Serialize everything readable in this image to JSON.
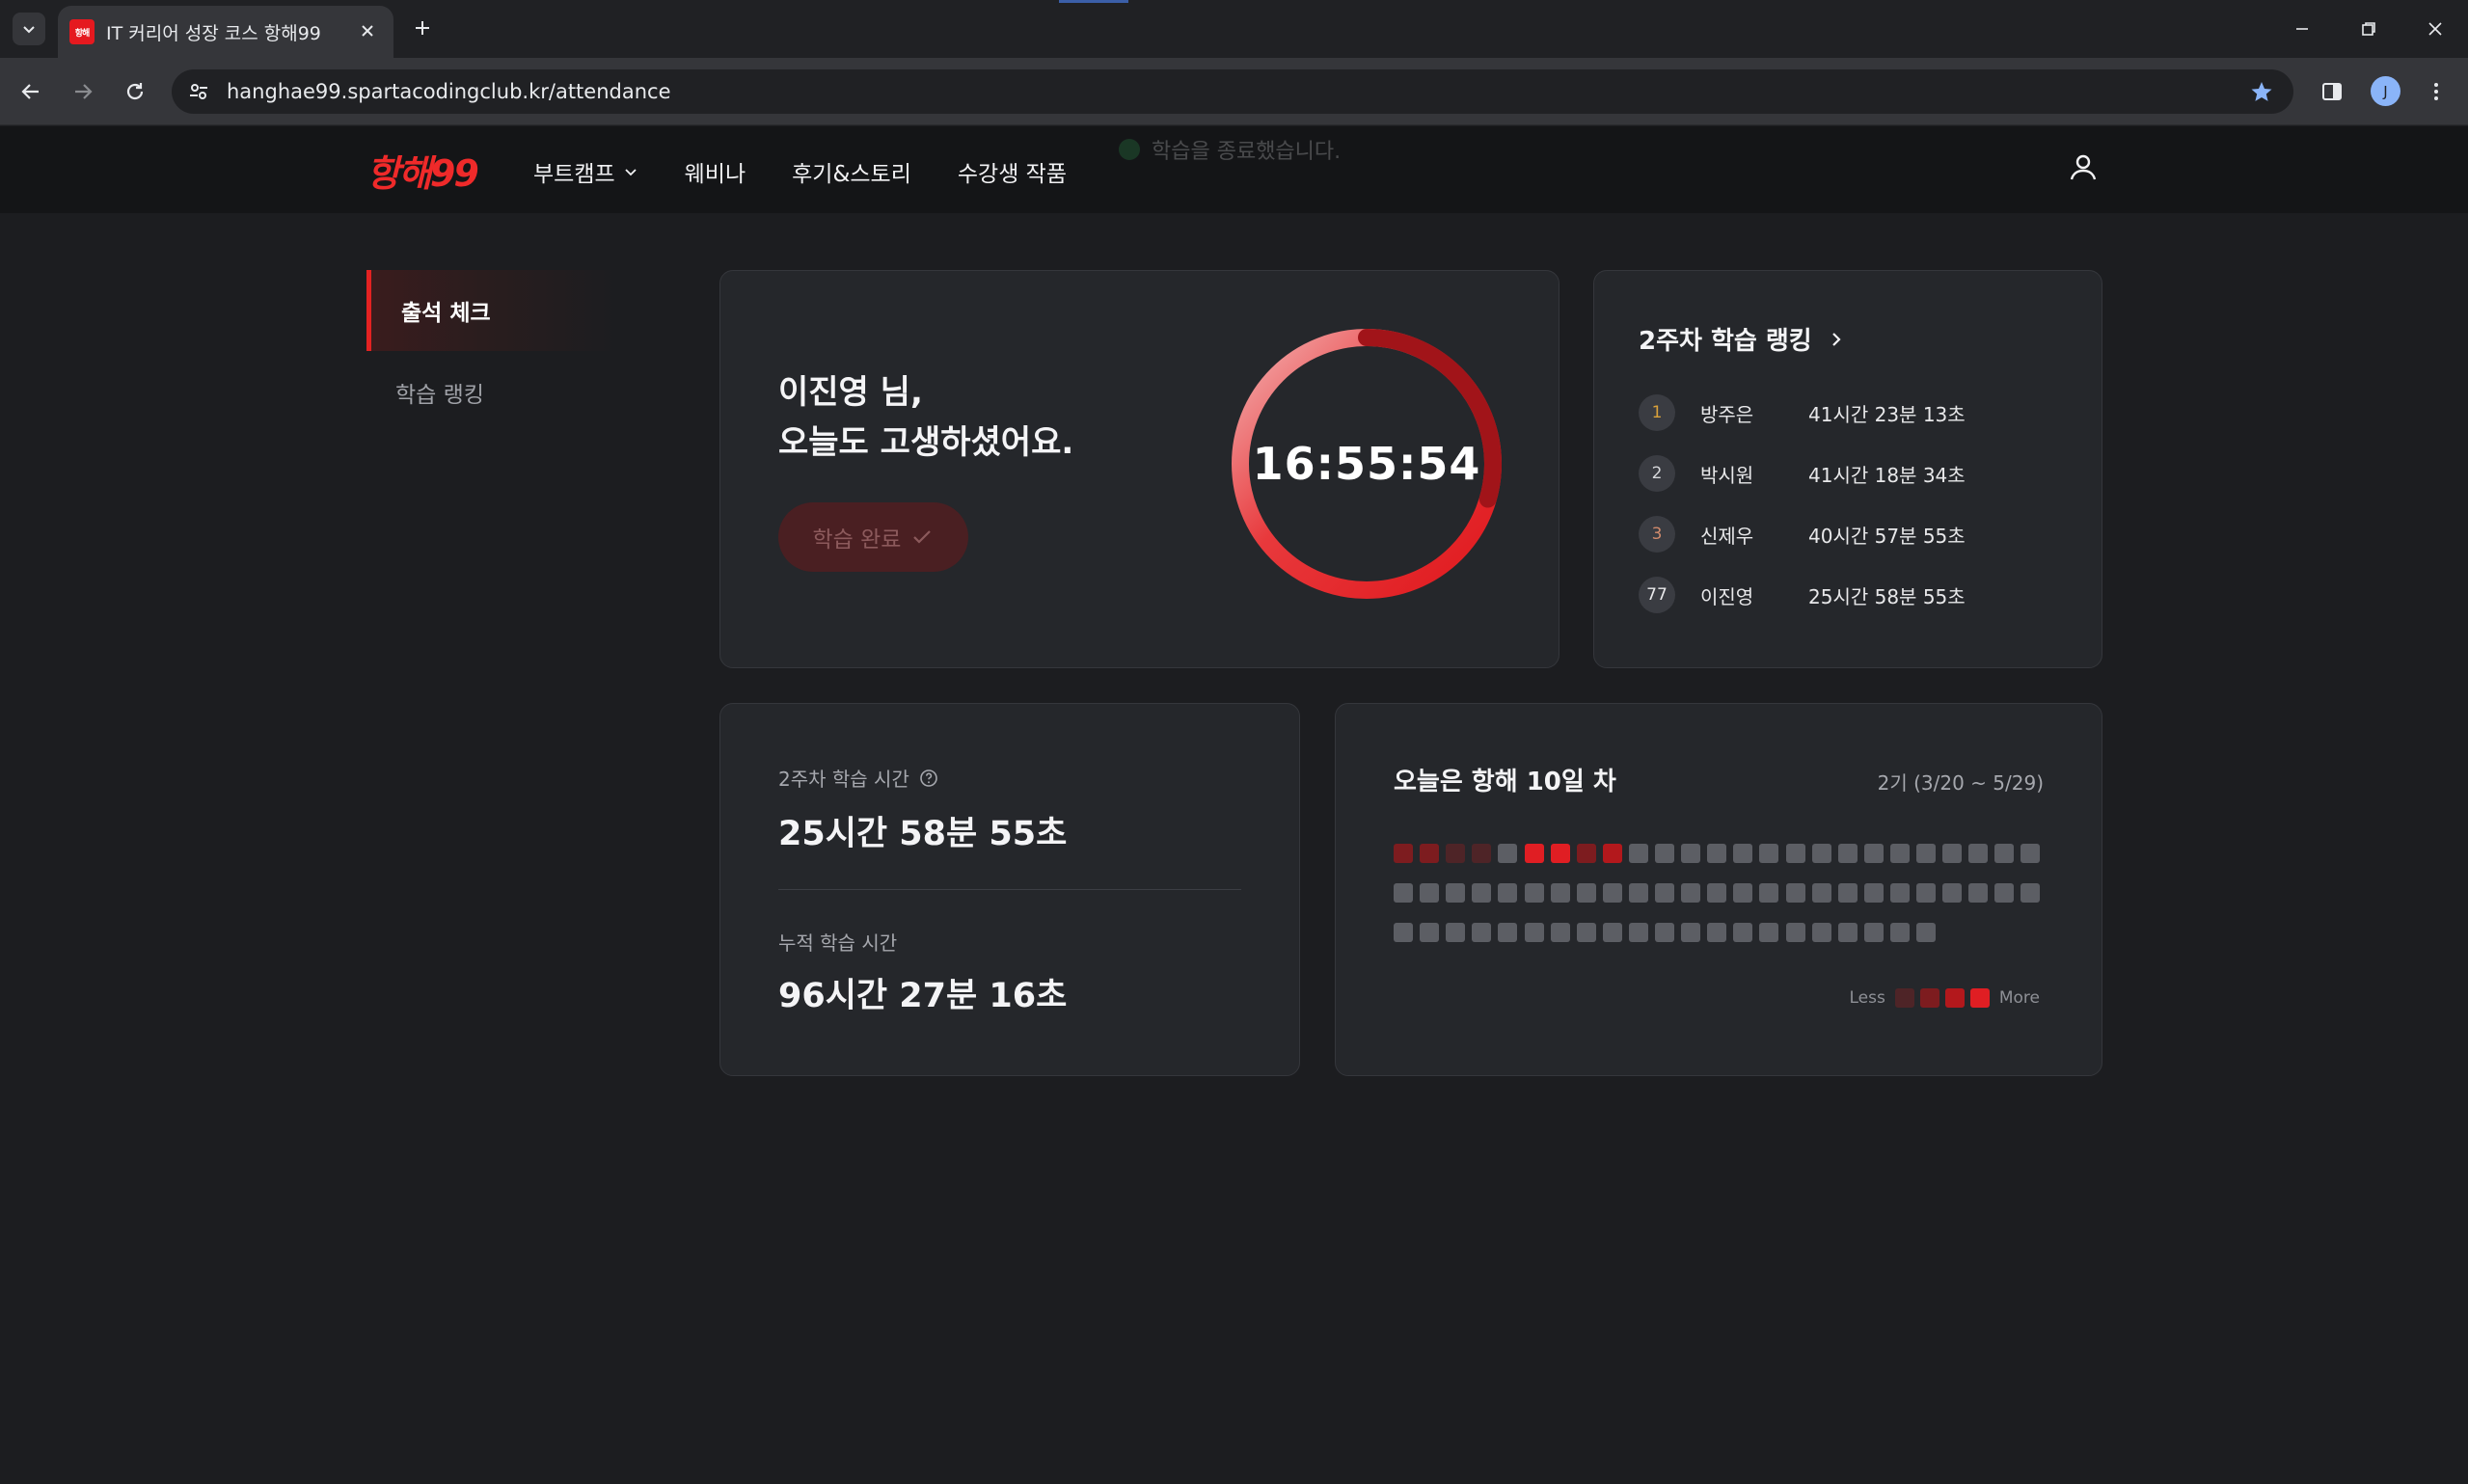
{
  "browser": {
    "tab_title": "IT 커리어 성장 코스 항해99",
    "favicon_text": "항해",
    "url": "hanghae99.spartacodingclub.kr/attendance",
    "profile_initial": "J"
  },
  "header": {
    "logo": "항해99",
    "nav": [
      "부트캠프",
      "웨비나",
      "후기&스토리",
      "수강생 작품"
    ],
    "toast": "학습을 종료했습니다."
  },
  "sidebar": {
    "items": [
      {
        "label": "출석 체크",
        "active": true
      },
      {
        "label": "학습 랭킹",
        "active": false
      }
    ]
  },
  "greeting": {
    "line1": "이진영 님,",
    "line2": "오늘도 고생하셨어요.",
    "button": "학습 완료",
    "timer": "16:55:54",
    "progress": 0.705
  },
  "ranking": {
    "title": "2주차 학습 랭킹",
    "rows": [
      {
        "rank": "1",
        "name": "방주은",
        "time": "41시간 23분 13초",
        "color": "#d9a13b"
      },
      {
        "rank": "2",
        "name": "박시원",
        "time": "41시간 18분 34초",
        "color": "#d6d7da"
      },
      {
        "rank": "3",
        "name": "신제우",
        "time": "40시간 57분 55초",
        "color": "#d08a6c"
      },
      {
        "rank": "77",
        "name": "이진영",
        "time": "25시간 58분 55초",
        "color": "#e8e8ea"
      }
    ]
  },
  "stats": {
    "weekly_label": "2주차 학습 시간",
    "weekly_value": "25시간 58분 55초",
    "total_label": "누적 학습 시간",
    "total_value": "96시간 27분 16초"
  },
  "calendar": {
    "title": "오늘은 항해 10일 차",
    "period": "2기 (3/20 ~ 5/29)",
    "legend_less": "Less",
    "legend_more": "More",
    "levels": [
      1,
      1,
      0,
      0,
      -1,
      3,
      3,
      1,
      2
    ],
    "total_days": 71,
    "palette": {
      "-1": "#5c5e64",
      "0": "#4e2427",
      "1": "#7d1c1f",
      "2": "#b3181c",
      "3": "#e01e23",
      "empty": "#5c5e64"
    }
  },
  "colors": {
    "accent": "#e32222",
    "bg": "#1c1d20",
    "card": "#25272b"
  }
}
